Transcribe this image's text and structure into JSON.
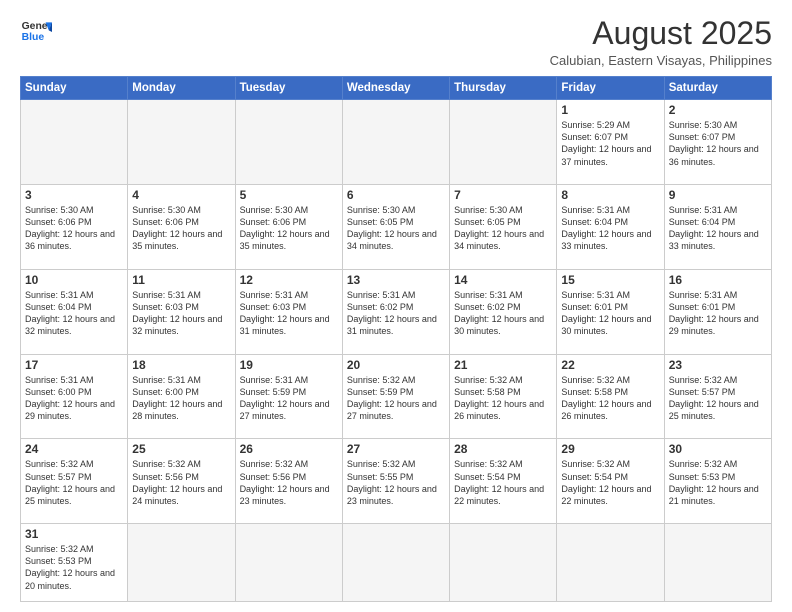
{
  "header": {
    "logo_line1": "General",
    "logo_line2": "Blue",
    "month_title": "August 2025",
    "subtitle": "Calubian, Eastern Visayas, Philippines"
  },
  "weekdays": [
    "Sunday",
    "Monday",
    "Tuesday",
    "Wednesday",
    "Thursday",
    "Friday",
    "Saturday"
  ],
  "weeks": [
    [
      {
        "day": "",
        "info": ""
      },
      {
        "day": "",
        "info": ""
      },
      {
        "day": "",
        "info": ""
      },
      {
        "day": "",
        "info": ""
      },
      {
        "day": "",
        "info": ""
      },
      {
        "day": "1",
        "info": "Sunrise: 5:29 AM\nSunset: 6:07 PM\nDaylight: 12 hours\nand 37 minutes."
      },
      {
        "day": "2",
        "info": "Sunrise: 5:30 AM\nSunset: 6:07 PM\nDaylight: 12 hours\nand 36 minutes."
      }
    ],
    [
      {
        "day": "3",
        "info": "Sunrise: 5:30 AM\nSunset: 6:06 PM\nDaylight: 12 hours\nand 36 minutes."
      },
      {
        "day": "4",
        "info": "Sunrise: 5:30 AM\nSunset: 6:06 PM\nDaylight: 12 hours\nand 35 minutes."
      },
      {
        "day": "5",
        "info": "Sunrise: 5:30 AM\nSunset: 6:06 PM\nDaylight: 12 hours\nand 35 minutes."
      },
      {
        "day": "6",
        "info": "Sunrise: 5:30 AM\nSunset: 6:05 PM\nDaylight: 12 hours\nand 34 minutes."
      },
      {
        "day": "7",
        "info": "Sunrise: 5:30 AM\nSunset: 6:05 PM\nDaylight: 12 hours\nand 34 minutes."
      },
      {
        "day": "8",
        "info": "Sunrise: 5:31 AM\nSunset: 6:04 PM\nDaylight: 12 hours\nand 33 minutes."
      },
      {
        "day": "9",
        "info": "Sunrise: 5:31 AM\nSunset: 6:04 PM\nDaylight: 12 hours\nand 33 minutes."
      }
    ],
    [
      {
        "day": "10",
        "info": "Sunrise: 5:31 AM\nSunset: 6:04 PM\nDaylight: 12 hours\nand 32 minutes."
      },
      {
        "day": "11",
        "info": "Sunrise: 5:31 AM\nSunset: 6:03 PM\nDaylight: 12 hours\nand 32 minutes."
      },
      {
        "day": "12",
        "info": "Sunrise: 5:31 AM\nSunset: 6:03 PM\nDaylight: 12 hours\nand 31 minutes."
      },
      {
        "day": "13",
        "info": "Sunrise: 5:31 AM\nSunset: 6:02 PM\nDaylight: 12 hours\nand 31 minutes."
      },
      {
        "day": "14",
        "info": "Sunrise: 5:31 AM\nSunset: 6:02 PM\nDaylight: 12 hours\nand 30 minutes."
      },
      {
        "day": "15",
        "info": "Sunrise: 5:31 AM\nSunset: 6:01 PM\nDaylight: 12 hours\nand 30 minutes."
      },
      {
        "day": "16",
        "info": "Sunrise: 5:31 AM\nSunset: 6:01 PM\nDaylight: 12 hours\nand 29 minutes."
      }
    ],
    [
      {
        "day": "17",
        "info": "Sunrise: 5:31 AM\nSunset: 6:00 PM\nDaylight: 12 hours\nand 29 minutes."
      },
      {
        "day": "18",
        "info": "Sunrise: 5:31 AM\nSunset: 6:00 PM\nDaylight: 12 hours\nand 28 minutes."
      },
      {
        "day": "19",
        "info": "Sunrise: 5:31 AM\nSunset: 5:59 PM\nDaylight: 12 hours\nand 27 minutes."
      },
      {
        "day": "20",
        "info": "Sunrise: 5:32 AM\nSunset: 5:59 PM\nDaylight: 12 hours\nand 27 minutes."
      },
      {
        "day": "21",
        "info": "Sunrise: 5:32 AM\nSunset: 5:58 PM\nDaylight: 12 hours\nand 26 minutes."
      },
      {
        "day": "22",
        "info": "Sunrise: 5:32 AM\nSunset: 5:58 PM\nDaylight: 12 hours\nand 26 minutes."
      },
      {
        "day": "23",
        "info": "Sunrise: 5:32 AM\nSunset: 5:57 PM\nDaylight: 12 hours\nand 25 minutes."
      }
    ],
    [
      {
        "day": "24",
        "info": "Sunrise: 5:32 AM\nSunset: 5:57 PM\nDaylight: 12 hours\nand 25 minutes."
      },
      {
        "day": "25",
        "info": "Sunrise: 5:32 AM\nSunset: 5:56 PM\nDaylight: 12 hours\nand 24 minutes."
      },
      {
        "day": "26",
        "info": "Sunrise: 5:32 AM\nSunset: 5:56 PM\nDaylight: 12 hours\nand 23 minutes."
      },
      {
        "day": "27",
        "info": "Sunrise: 5:32 AM\nSunset: 5:55 PM\nDaylight: 12 hours\nand 23 minutes."
      },
      {
        "day": "28",
        "info": "Sunrise: 5:32 AM\nSunset: 5:54 PM\nDaylight: 12 hours\nand 22 minutes."
      },
      {
        "day": "29",
        "info": "Sunrise: 5:32 AM\nSunset: 5:54 PM\nDaylight: 12 hours\nand 22 minutes."
      },
      {
        "day": "30",
        "info": "Sunrise: 5:32 AM\nSunset: 5:53 PM\nDaylight: 12 hours\nand 21 minutes."
      }
    ],
    [
      {
        "day": "31",
        "info": "Sunrise: 5:32 AM\nSunset: 5:53 PM\nDaylight: 12 hours\nand 20 minutes."
      },
      {
        "day": "",
        "info": ""
      },
      {
        "day": "",
        "info": ""
      },
      {
        "day": "",
        "info": ""
      },
      {
        "day": "",
        "info": ""
      },
      {
        "day": "",
        "info": ""
      },
      {
        "day": "",
        "info": ""
      }
    ]
  ]
}
